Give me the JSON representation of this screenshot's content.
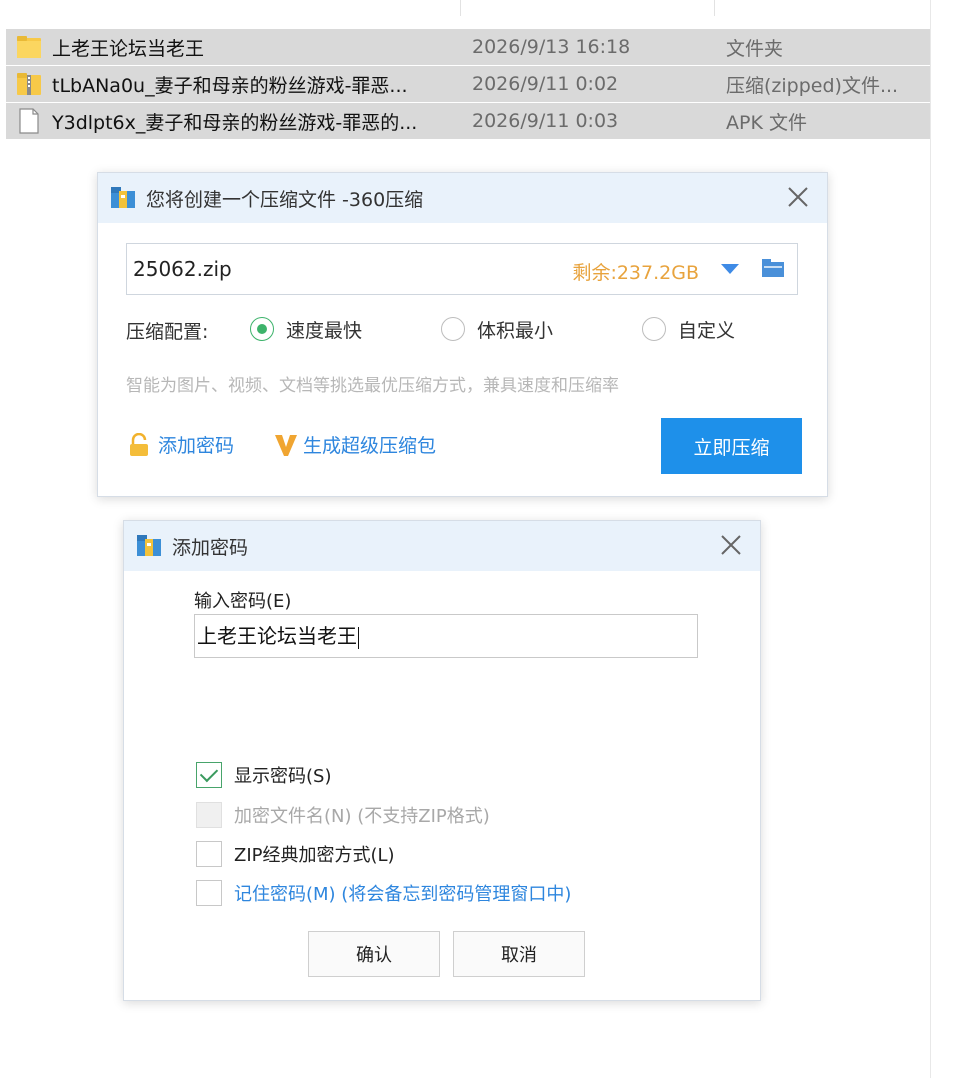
{
  "explorer": {
    "files": [
      {
        "name": "上老王论坛当老王",
        "date": "2026/9/13 16:18",
        "type": "文件夹",
        "icon": "folder-icon"
      },
      {
        "name": "tLbANa0u_妻子和母亲的粉丝游戏-罪恶...",
        "date": "2026/9/11 0:02",
        "type": "压缩(zipped)文件...",
        "icon": "zip-folder-icon"
      },
      {
        "name": "Y3dlpt6x_妻子和母亲的粉丝游戏-罪恶的...",
        "date": "2026/9/11 0:03",
        "type": "APK 文件",
        "icon": "file-icon"
      }
    ]
  },
  "compress_dialog": {
    "title": "您将创建一个压缩文件 -360压缩",
    "filename": "25062.zip",
    "remaining": "剩余:237.2GB",
    "config_label": "压缩配置:",
    "options": [
      {
        "label": "速度最快",
        "selected": true
      },
      {
        "label": "体积最小",
        "selected": false
      },
      {
        "label": "自定义",
        "selected": false
      }
    ],
    "hint": "智能为图片、视频、文档等挑选最优压缩方式，兼具速度和压缩率",
    "add_password": "添加密码",
    "super_pack": "生成超级压缩包",
    "compress_button": "立即压缩",
    "colors": {
      "accent": "#1e90ea",
      "title_bg": "#e9f2fb",
      "remaining": "#e8a33d"
    }
  },
  "password_dialog": {
    "title": "添加密码",
    "input_label": "输入密码(E)",
    "password": "上老王论坛当老王",
    "options": [
      {
        "label": "显示密码(S)",
        "checked": true,
        "disabled": false
      },
      {
        "label": "加密文件名(N) (不支持ZIP格式)",
        "checked": false,
        "disabled": true
      },
      {
        "label": "ZIP经典加密方式(L)",
        "checked": false,
        "disabled": false
      },
      {
        "label": "记住密码(M) (将会备忘到密码管理窗口中)",
        "checked": false,
        "disabled": false
      }
    ],
    "ok": "确认",
    "cancel": "取消"
  }
}
